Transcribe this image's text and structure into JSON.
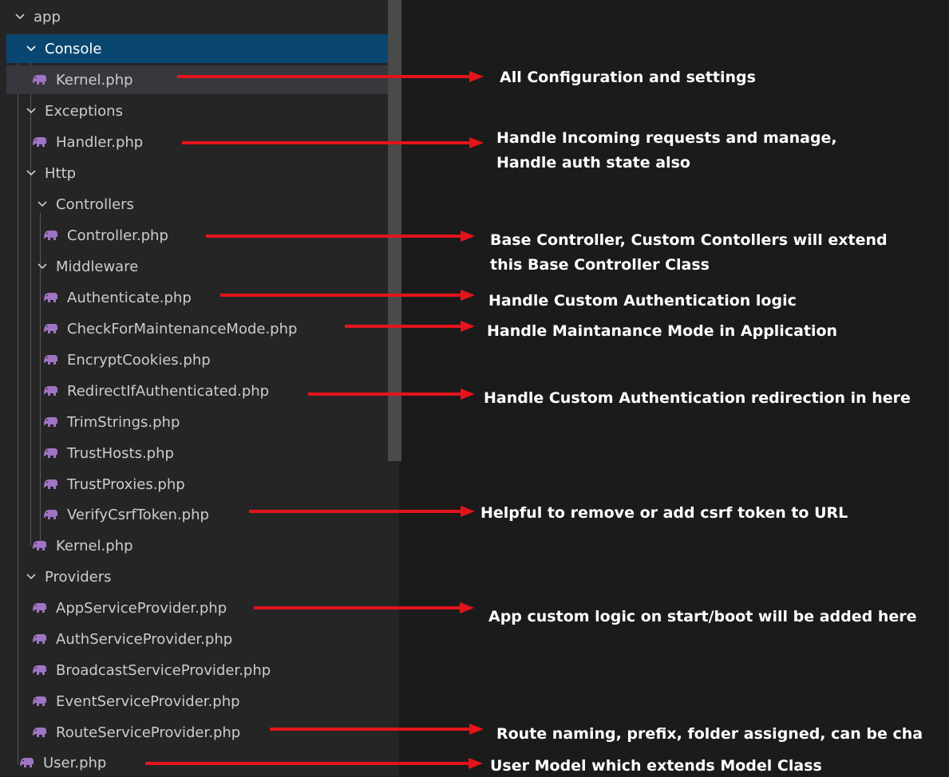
{
  "colors": {
    "background": "#1b1b1b",
    "tree_background": "#252526",
    "selected_row": "#094771",
    "text": "#cccccc",
    "php_icon": "#a074c4",
    "arrow": "#e3141c",
    "annotation_text": "#ffffff"
  },
  "tree": [
    {
      "label": "app",
      "type": "folder",
      "expanded": true,
      "icon": "chevron-down-icon"
    },
    {
      "label": "Console",
      "type": "folder",
      "expanded": true,
      "selected": true,
      "icon": "chevron-down-icon"
    },
    {
      "label": "Kernel.php",
      "type": "file",
      "icon": "php-elephant-icon"
    },
    {
      "label": "Exceptions",
      "type": "folder",
      "expanded": true,
      "icon": "chevron-down-icon"
    },
    {
      "label": "Handler.php",
      "type": "file",
      "icon": "php-elephant-icon"
    },
    {
      "label": "Http",
      "type": "folder",
      "expanded": true,
      "icon": "chevron-down-icon"
    },
    {
      "label": "Controllers",
      "type": "folder",
      "expanded": true,
      "icon": "chevron-down-icon"
    },
    {
      "label": "Controller.php",
      "type": "file",
      "icon": "php-elephant-icon"
    },
    {
      "label": "Middleware",
      "type": "folder",
      "expanded": true,
      "icon": "chevron-down-icon"
    },
    {
      "label": "Authenticate.php",
      "type": "file",
      "icon": "php-elephant-icon"
    },
    {
      "label": "CheckForMaintenanceMode.php",
      "type": "file",
      "icon": "php-elephant-icon"
    },
    {
      "label": "EncryptCookies.php",
      "type": "file",
      "icon": "php-elephant-icon"
    },
    {
      "label": "RedirectIfAuthenticated.php",
      "type": "file",
      "icon": "php-elephant-icon"
    },
    {
      "label": "TrimStrings.php",
      "type": "file",
      "icon": "php-elephant-icon"
    },
    {
      "label": "TrustHosts.php",
      "type": "file",
      "icon": "php-elephant-icon"
    },
    {
      "label": "TrustProxies.php",
      "type": "file",
      "icon": "php-elephant-icon"
    },
    {
      "label": "VerifyCsrfToken.php",
      "type": "file",
      "icon": "php-elephant-icon"
    },
    {
      "label": "Kernel.php",
      "type": "file",
      "icon": "php-elephant-icon"
    },
    {
      "label": "Providers",
      "type": "folder",
      "expanded": true,
      "icon": "chevron-down-icon"
    },
    {
      "label": "AppServiceProvider.php",
      "type": "file",
      "icon": "php-elephant-icon"
    },
    {
      "label": "AuthServiceProvider.php",
      "type": "file",
      "icon": "php-elephant-icon"
    },
    {
      "label": "BroadcastServiceProvider.php",
      "type": "file",
      "icon": "php-elephant-icon"
    },
    {
      "label": "EventServiceProvider.php",
      "type": "file",
      "icon": "php-elephant-icon"
    },
    {
      "label": "RouteServiceProvider.php",
      "type": "file",
      "icon": "php-elephant-icon"
    },
    {
      "label": "User.php",
      "type": "file",
      "icon": "php-elephant-icon"
    }
  ],
  "annotations": [
    {
      "file": "Kernel.php",
      "lines": [
        "All Configuration and settings"
      ]
    },
    {
      "file": "Handler.php",
      "lines": [
        "Handle Incoming requests and manage,",
        "Handle auth state also"
      ]
    },
    {
      "file": "Controller.php",
      "lines": [
        "Base Controller, Custom Contollers will extend",
        "this Base Controller Class"
      ]
    },
    {
      "file": "Authenticate.php",
      "lines": [
        "Handle Custom Authentication logic"
      ]
    },
    {
      "file": "CheckForMaintenanceMode.php",
      "lines": [
        "Handle Maintanance Mode in Application"
      ]
    },
    {
      "file": "RedirectIfAuthenticated.php",
      "lines": [
        "Handle Custom Authentication redirection in here"
      ]
    },
    {
      "file": "VerifyCsrfToken.php",
      "lines": [
        "Helpful to remove or add csrf token to URL"
      ]
    },
    {
      "file": "AppServiceProvider.php",
      "lines": [
        "App custom logic on start/boot will be added here"
      ]
    },
    {
      "file": "RouteServiceProvider.php",
      "lines": [
        "Route naming, prefix, folder assigned, can be cha"
      ]
    },
    {
      "file": "User.php",
      "lines": [
        "User Model which extends Model Class"
      ]
    }
  ]
}
